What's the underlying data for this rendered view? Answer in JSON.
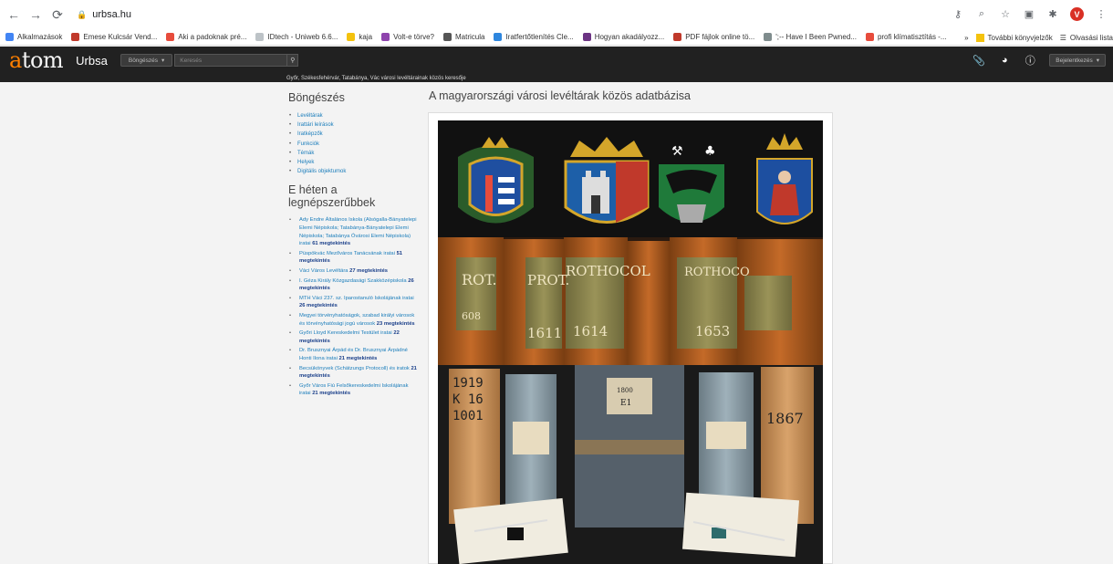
{
  "browser": {
    "url": "urbsa.hu",
    "bookmarks": [
      {
        "label": "Alkalmazások",
        "color": "#4285f4"
      },
      {
        "label": "Emese Kulcsár Vend...",
        "color": "#c0392b"
      },
      {
        "label": "Aki a padoknak pré...",
        "color": "#e74c3c"
      },
      {
        "label": "IDtech - Uniweb 6.6...",
        "color": "#bdc3c7"
      },
      {
        "label": "kaja",
        "color": "#f4c20d"
      },
      {
        "label": "Volt-e törve?",
        "color": "#8e44ad"
      },
      {
        "label": "Matricula",
        "color": "#555555"
      },
      {
        "label": "Iratfertőtlenítés Cle...",
        "color": "#2e86de"
      },
      {
        "label": "Hogyan akadályozz...",
        "color": "#6c3483"
      },
      {
        "label": "PDF fájlok online tö...",
        "color": "#c0392b"
      },
      {
        "label": "';-- Have I Been Pwned...",
        "color": "#7f8c8d"
      },
      {
        "label": "profi klímatisztítás -...",
        "color": "#e74c3c"
      }
    ],
    "bookmarks_more": "»",
    "other_bookmarks": "További könyvjelzők",
    "reading_list": "Olvasási lista",
    "avatar_letter": "V"
  },
  "header": {
    "logo_a": "a",
    "logo_rest": "tom",
    "site_title": "Urbsa",
    "browse_label": "Böngészés",
    "search_placeholder": "Keresés",
    "login_label": "Bejelentkezés",
    "description": "Győr, Székesfehérvár, Tatabánya, Vác városi levéltárainak közös keresője"
  },
  "sidebar": {
    "browse_title": "Böngészés",
    "browse_items": [
      "Levéltárak",
      "Irattári leírások",
      "Iratképzők",
      "Funkciók",
      "Témák",
      "Helyek",
      "Digitális objektumok"
    ],
    "popular_title": "E héten a legnépszerűbbek",
    "popular_items": [
      {
        "text": "Ady Endre Általános Iskola (Alsógalla-Bányatelepi Elemi Népiskola; Tatabánya-Bányatelepi Elemi Népiskola; Tatabánya Óvárosi Elemi Népiskola) iratai",
        "count": "61 megtekintés"
      },
      {
        "text": "Püspökvác Mezőváros Tanácsának iratai",
        "count": "51 megtekintés"
      },
      {
        "text": "Váci Város Levéltára",
        "count": "27 megtekintés"
      },
      {
        "text": "I. Géza Király Közgazdasági Szakközépiskola",
        "count": "26 megtekintés"
      },
      {
        "text": "MTH Váci 237. sz. Iparostanuló Iskolájának iratai",
        "count": "26 megtekintés"
      },
      {
        "text": "Megyei törvényhatóságok, szabad királyi városok és törvényhatósági jogú városok",
        "count": "23 megtekintés"
      },
      {
        "text": "Győri Lloyd Kereskedelmi Testület iratai",
        "count": "22 megtekintés"
      },
      {
        "text": "Dr. Brusznyai Árpád és Dr. Brusznyai Árpádné Honti Ilona iratai",
        "count": "21 megtekintés"
      },
      {
        "text": "Becsükönyvek (Schätzungs Protocoll) és iratok",
        "count": "21 megtekintés"
      },
      {
        "text": "Győr Város Fiú Felsőkereskedelmi Iskolájának iratai",
        "count": "21 megtekintés"
      }
    ]
  },
  "main": {
    "title": "A magyarországi városi levéltárak közös adatbázisa",
    "spine_labels": [
      "ROT.",
      "PROT.",
      "ROTHOCOL",
      "ROTHOCO",
      "608",
      "1611",
      "1614",
      "1653"
    ],
    "box_labels": [
      "1919",
      "K 16",
      "1001",
      "1867",
      "1800",
      "E1"
    ]
  }
}
